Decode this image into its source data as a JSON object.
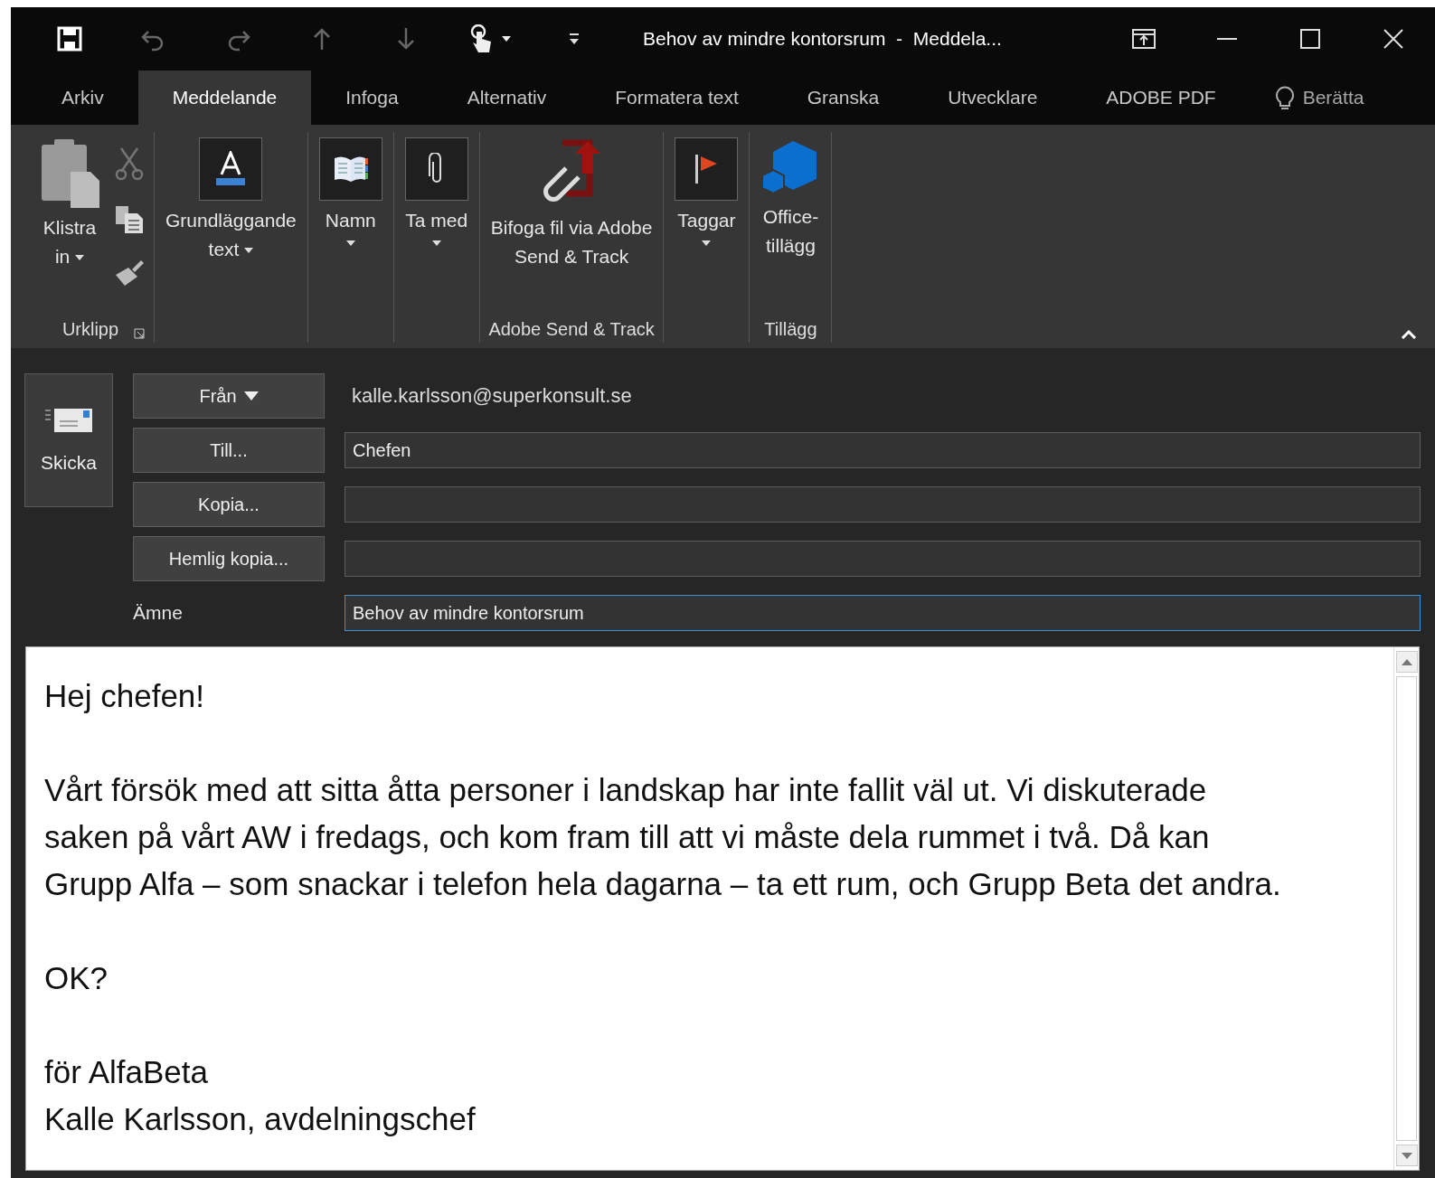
{
  "window": {
    "title": "Behov av mindre kontorsrum  -  Meddela..."
  },
  "tabs": [
    {
      "label": "Arkiv",
      "selected": false
    },
    {
      "label": "Meddelande",
      "selected": true
    },
    {
      "label": "Infoga",
      "selected": false
    },
    {
      "label": "Alternativ",
      "selected": false
    },
    {
      "label": "Formatera text",
      "selected": false
    },
    {
      "label": "Granska",
      "selected": false
    },
    {
      "label": "Utvecklare",
      "selected": false
    },
    {
      "label": "ADOBE PDF",
      "selected": false
    }
  ],
  "tell_me": {
    "placeholder": "Berätta"
  },
  "ribbon": {
    "groups": [
      {
        "label": "Urklipp",
        "launcher": true,
        "buttons": [
          {
            "kind": "paste",
            "label": "Klistra\nin",
            "dropdown": true
          },
          {
            "kind": "cut",
            "disabled": true
          },
          {
            "kind": "copy",
            "disabled": false
          },
          {
            "kind": "painter",
            "disabled": false
          }
        ]
      },
      {
        "buttons": [
          {
            "kind": "font",
            "label": "Grundläggande\ntext",
            "dropdown": true
          }
        ]
      },
      {
        "buttons": [
          {
            "kind": "addressbook",
            "label": "Namn",
            "dropdown": true
          }
        ]
      },
      {
        "buttons": [
          {
            "kind": "attach",
            "label": "Ta med",
            "dropdown": true
          }
        ]
      },
      {
        "label": "Adobe Send & Track",
        "buttons": [
          {
            "kind": "adobe",
            "label": "Bifoga fil via Adobe\nSend & Track"
          }
        ]
      },
      {
        "buttons": [
          {
            "kind": "flag",
            "label": "Taggar",
            "dropdown": true
          }
        ]
      },
      {
        "label": "Tillägg",
        "buttons": [
          {
            "kind": "addins",
            "label": "Office-\ntillägg"
          }
        ]
      }
    ]
  },
  "compose": {
    "send_button": "Skicka",
    "from": {
      "button": "Från",
      "value": "kalle.karlsson@superkonsult.se"
    },
    "fields": [
      {
        "button": "Till...",
        "value": "Chefen",
        "focused": false
      },
      {
        "button": "Kopia...",
        "focused": false
      },
      {
        "button": "Hemlig kopia...",
        "focused": false
      }
    ],
    "subject": {
      "label": "Ämne",
      "value": "Behov av mindre kontorsrum",
      "focused": true
    }
  },
  "body": {
    "paragraphs": [
      {
        "lines": [
          "Hej chefen!"
        ]
      },
      {
        "lines": [
          "Vårt försök med att sitta åtta personer i landskap har inte fallit väl ut. Vi diskuterade",
          "saken på vårt AW i fredags, och kom fram till att vi måste dela rummet i två. Då kan",
          "Grupp Alfa – som snackar i telefon hela dagarna – ta ett rum, och Grupp Beta det andra."
        ]
      },
      {
        "lines": [
          "OK?"
        ]
      },
      {
        "lines": [
          "för AlfaBeta",
          "Kalle Karlsson, avdelningschef"
        ]
      }
    ]
  }
}
